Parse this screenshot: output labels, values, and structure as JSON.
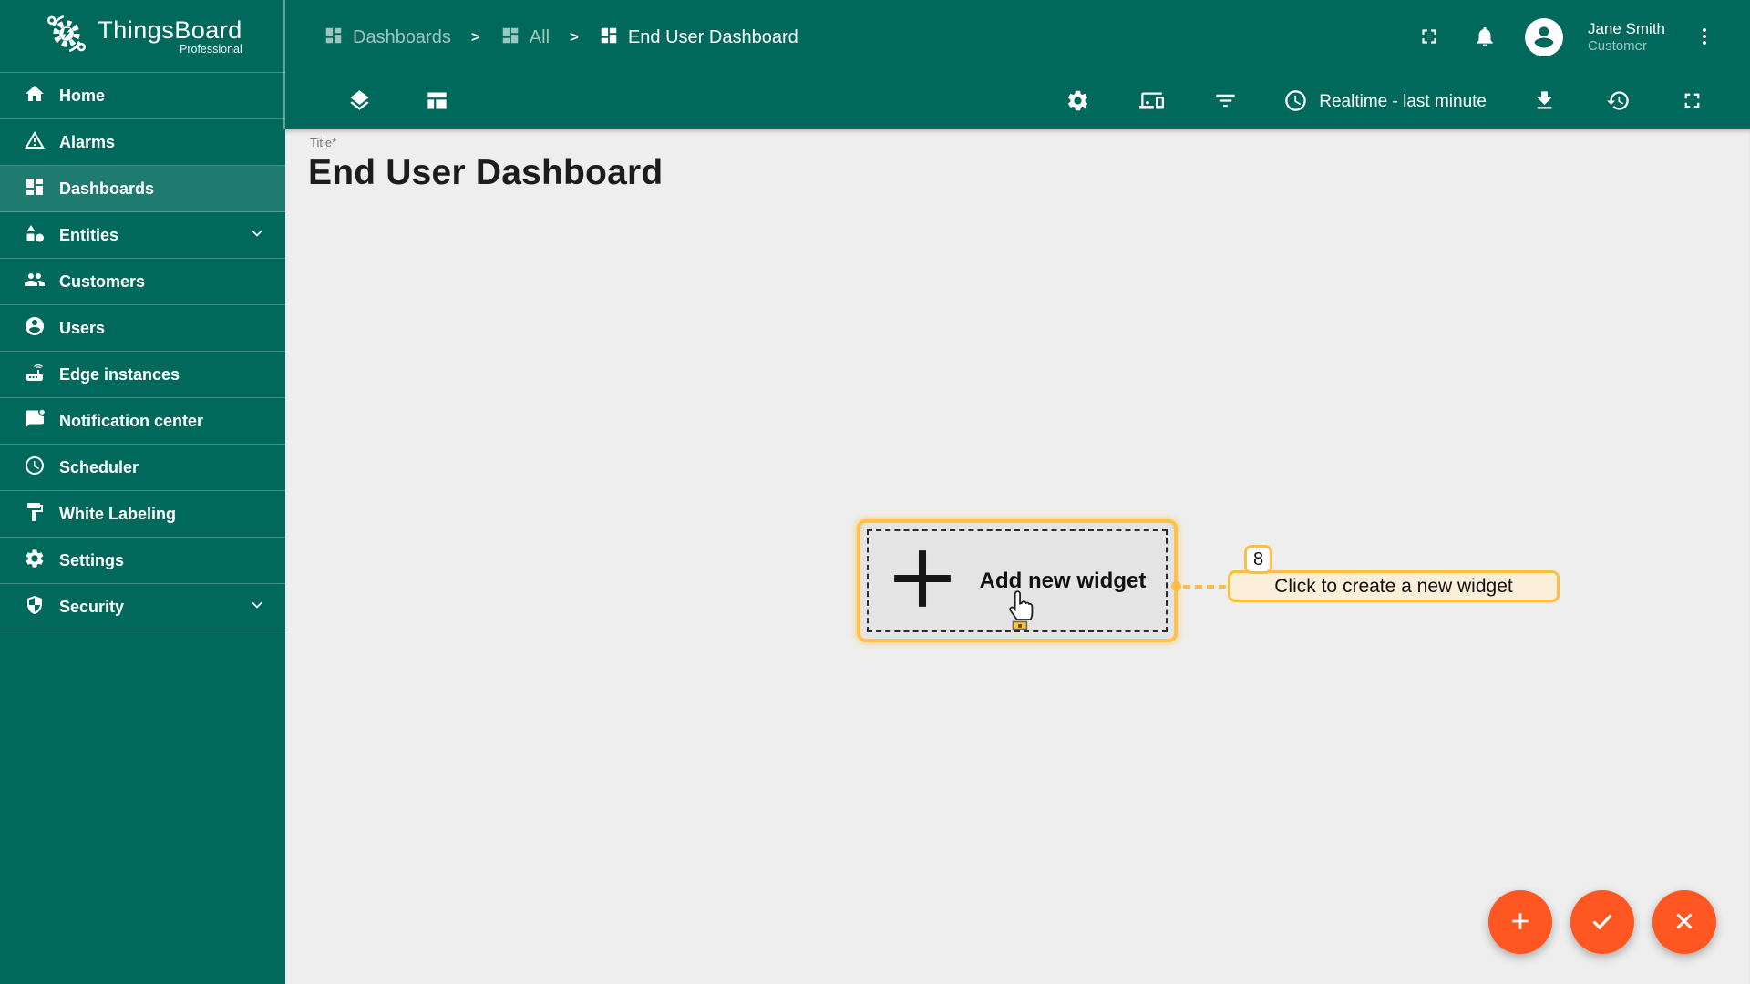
{
  "app": {
    "name": "ThingsBoard",
    "edition": "Professional"
  },
  "sidebar": {
    "items": [
      {
        "label": "Home"
      },
      {
        "label": "Alarms"
      },
      {
        "label": "Dashboards",
        "selected": true
      },
      {
        "label": "Entities",
        "expandable": true
      },
      {
        "label": "Customers"
      },
      {
        "label": "Users"
      },
      {
        "label": "Edge instances"
      },
      {
        "label": "Notification center"
      },
      {
        "label": "Scheduler"
      },
      {
        "label": "White Labeling"
      },
      {
        "label": "Settings"
      },
      {
        "label": "Security",
        "expandable": true
      }
    ]
  },
  "header": {
    "breadcrumb": [
      {
        "label": "Dashboards"
      },
      {
        "label": "All"
      },
      {
        "label": "End User Dashboard"
      }
    ],
    "separator": ">",
    "user": {
      "name": "Jane Smith",
      "role": "Customer"
    }
  },
  "toolbar": {
    "time_window": "Realtime - last minute"
  },
  "main": {
    "title_label": "Title*",
    "title_value": "End User Dashboard",
    "add_widget": {
      "label": "Add new widget"
    },
    "tour": {
      "step": "8",
      "tooltip": "Click to create a new widget"
    }
  },
  "colors": {
    "sidebar_teal": "#00695c",
    "selected_item_overlay": "rgba(255,255,255,0.12)",
    "content_bg": "#eeeeee",
    "fab_orange": "#ff5722",
    "tour_accent": "#ffbd45",
    "tooltip_bg": "#fcefd9"
  }
}
